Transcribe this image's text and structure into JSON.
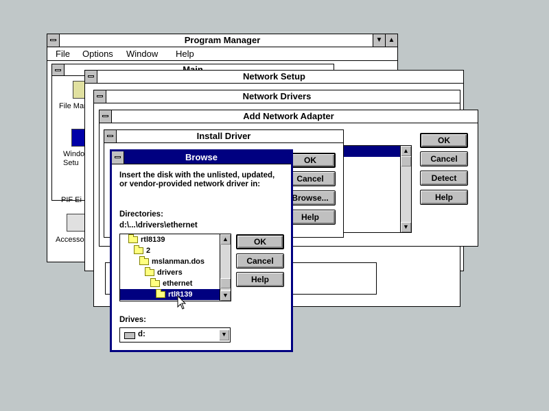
{
  "program_manager": {
    "title": "Program Manager",
    "menu": [
      "File",
      "Options",
      "Window",
      "Help"
    ],
    "group_title": "Main",
    "icons": [
      "File Manager",
      "Windows Setup",
      "PIF Editor",
      "Accessories"
    ],
    "icon_visible": [
      "File Mar",
      "Windo\nSetu",
      "PIF Ei",
      "Accesso"
    ]
  },
  "network_setup": {
    "title": "Network Setup"
  },
  "network_drivers": {
    "title": "Network Drivers"
  },
  "add_adapter": {
    "title": "Add Network Adapter",
    "buttons": {
      "ok": "OK",
      "cancel": "Cancel",
      "detect": "Detect",
      "help": "Help"
    }
  },
  "install_driver": {
    "title": "Install Driver",
    "buttons": {
      "ok": "OK",
      "cancel": "Cancel",
      "browse": "Browse...",
      "help": "Help"
    }
  },
  "browse": {
    "title": "Browse",
    "instruction": "Insert the disk with the unlisted, updated, or vendor-provided network driver in:",
    "directories_label": "Directories:",
    "current_path": "d:\\...\\drivers\\ethernet",
    "dir_items": [
      {
        "name": "rtl8139",
        "indent": 0
      },
      {
        "name": "2",
        "indent": 1
      },
      {
        "name": "mslanman.dos",
        "indent": 2
      },
      {
        "name": "drivers",
        "indent": 3
      },
      {
        "name": "ethernet",
        "indent": 4
      },
      {
        "name": "rtl8139",
        "indent": 5,
        "selected": true
      }
    ],
    "drives_label": "Drives:",
    "drive_value": "d:",
    "buttons": {
      "ok": "OK",
      "cancel": "Cancel",
      "help": "Help"
    }
  },
  "colors": {
    "desktop": "#c0c7c8",
    "active_title": "#000080",
    "selection": "#000080"
  }
}
